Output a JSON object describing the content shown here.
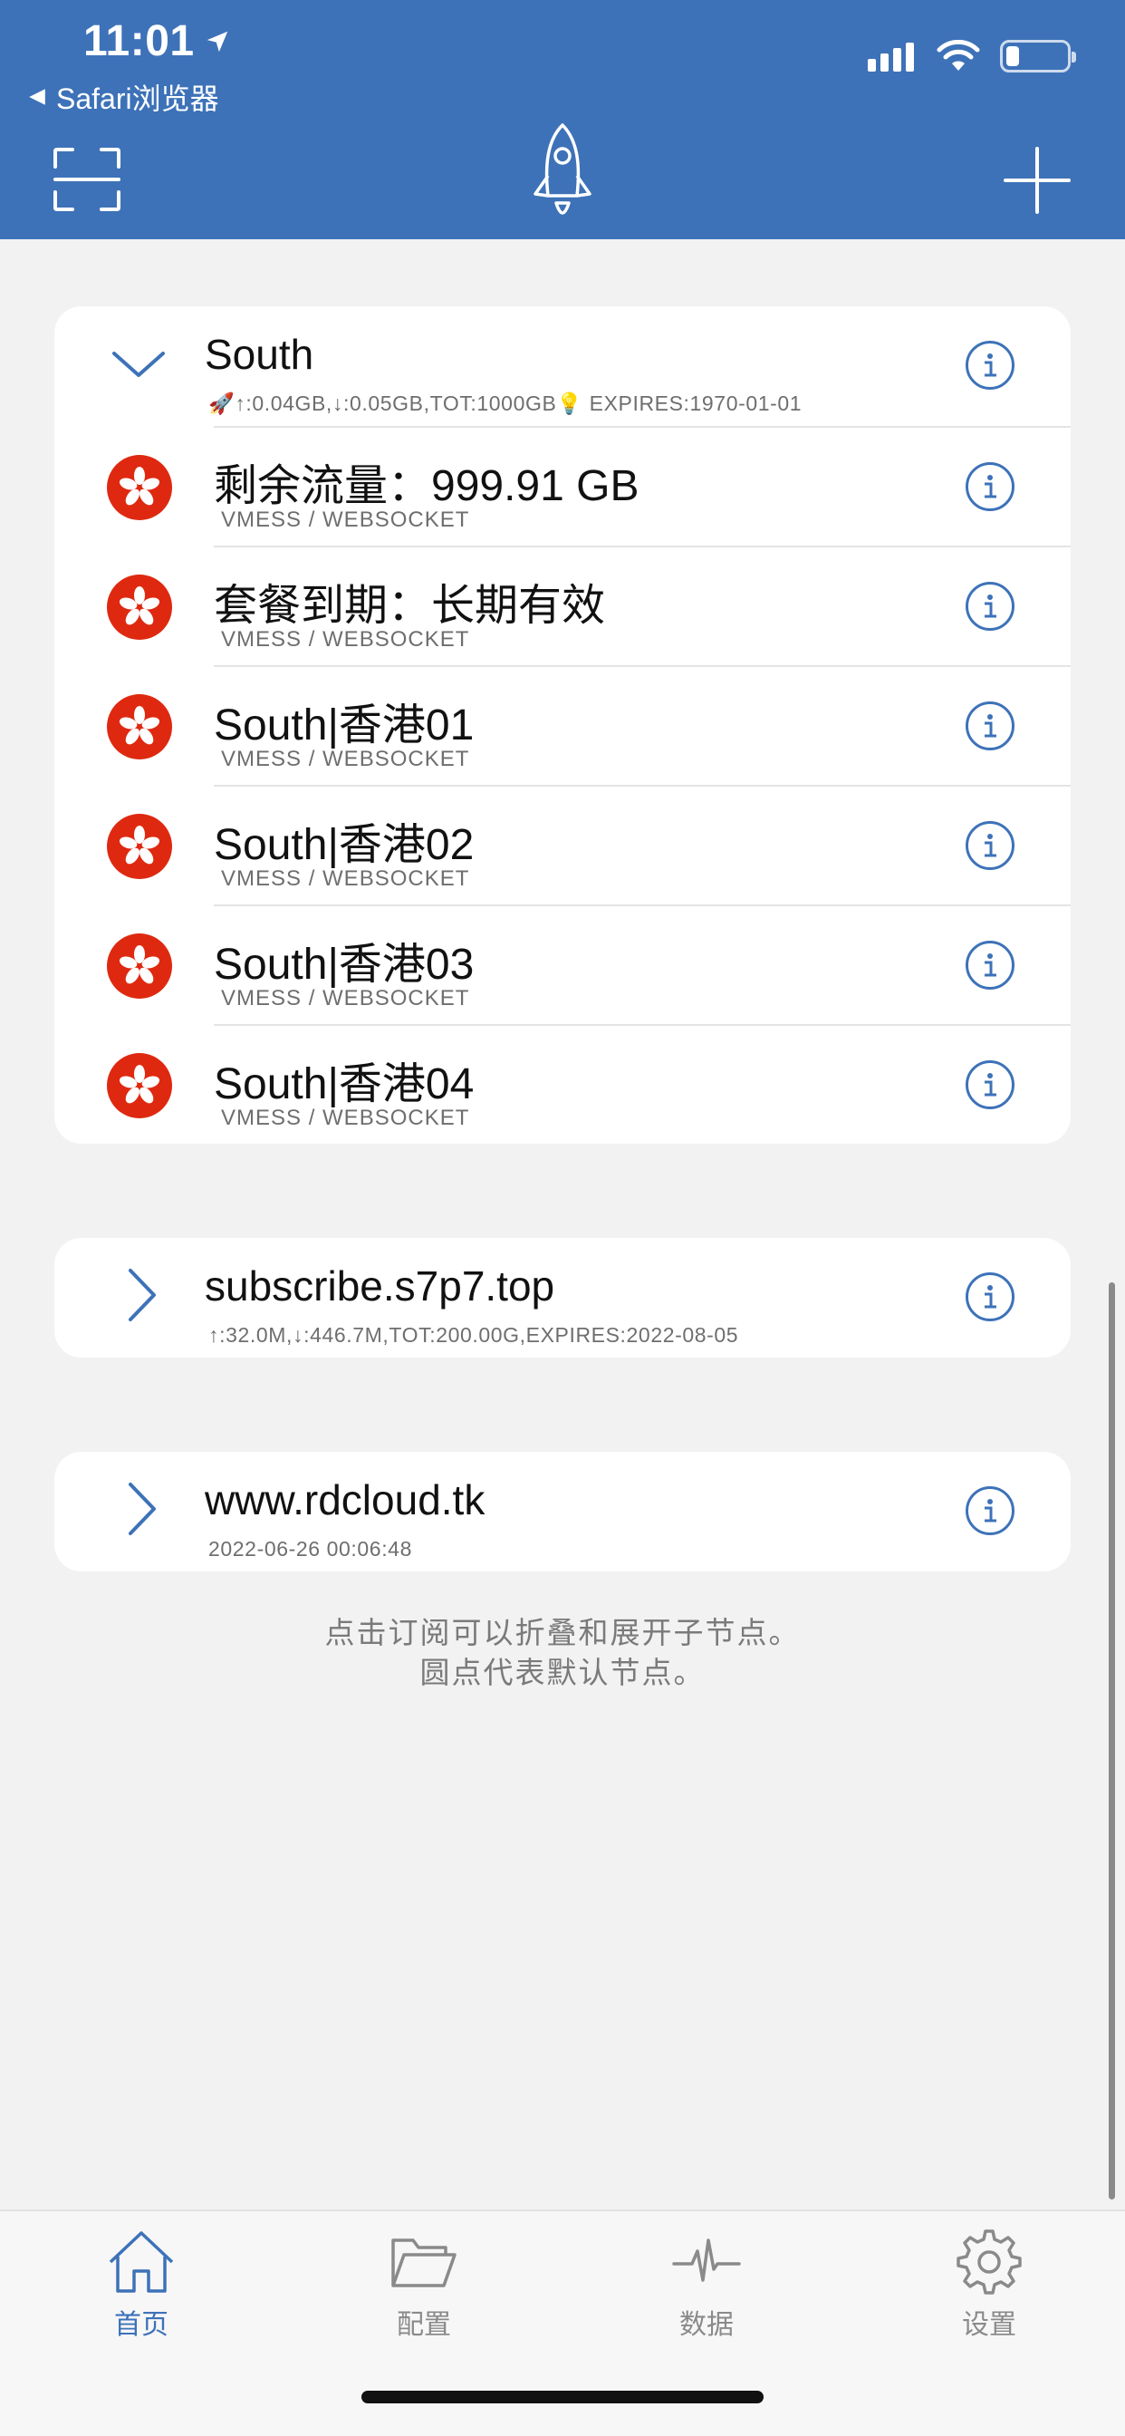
{
  "status_bar": {
    "time": "11:01",
    "back_app": "Safari浏览器"
  },
  "header": {
    "icons": [
      "scan-icon",
      "rocket-icon",
      "plus-icon"
    ],
    "bar_color": "#3d72b8"
  },
  "groups": [
    {
      "title": "South",
      "subtitle": "🚀↑:0.04GB,↓:0.05GB,TOT:1000GB💡 EXPIRES:1970-01-01",
      "expanded": true,
      "nodes": [
        {
          "title": "剩余流量：999.91 GB",
          "subtitle": "VMESS / WEBSOCKET"
        },
        {
          "title": "套餐到期：长期有效",
          "subtitle": "VMESS / WEBSOCKET"
        },
        {
          "title": "South|香港01",
          "subtitle": "VMESS / WEBSOCKET"
        },
        {
          "title": "South|香港02",
          "subtitle": "VMESS / WEBSOCKET"
        },
        {
          "title": "South|香港03",
          "subtitle": "VMESS / WEBSOCKET"
        },
        {
          "title": "South|香港04",
          "subtitle": "VMESS / WEBSOCKET"
        }
      ]
    },
    {
      "title": "subscribe.s7p7.top",
      "subtitle": "↑:32.0M,↓:446.7M,TOT:200.00G,EXPIRES:2022-08-05",
      "expanded": false
    },
    {
      "title": "www.rdcloud.tk",
      "subtitle": "2022-06-26 00:06:48",
      "expanded": false
    }
  ],
  "hint": {
    "line1": "点击订阅可以折叠和展开子节点。",
    "line2": "圆点代表默认节点。"
  },
  "tabs": [
    {
      "label": "首页",
      "icon": "home-icon",
      "active": true
    },
    {
      "label": "配置",
      "icon": "folder-icon",
      "active": false
    },
    {
      "label": "数据",
      "icon": "pulse-icon",
      "active": false
    },
    {
      "label": "设置",
      "icon": "gear-icon",
      "active": false
    }
  ],
  "colors": {
    "accent": "#3d72b8",
    "flag_red": "#de2910",
    "background": "#f2f2f2"
  }
}
